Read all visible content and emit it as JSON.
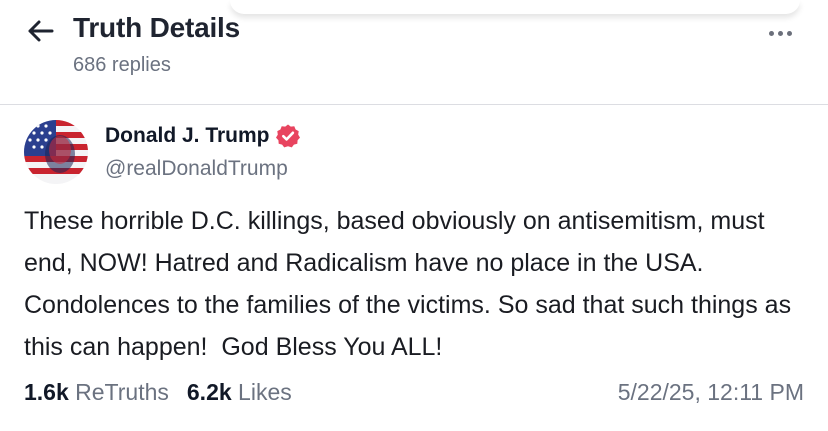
{
  "header": {
    "title": "Truth Details",
    "replies": "686 replies"
  },
  "post": {
    "author": {
      "name": "Donald J. Trump",
      "handle": "@realDonaldTrump",
      "verified": true
    },
    "text": "These horrible D.C. killings, based obviously on antisemitism, must end, NOW! Hatred and Radicalism have no place in the USA. Condolences to the families of the victims. So sad that such things as this can happen!  God Bless You ALL!",
    "retruths_count": "1.6k",
    "retruths_label": "ReTruths",
    "likes_count": "6.2k",
    "likes_label": "Likes",
    "timestamp": "5/22/25, 12:11 PM"
  },
  "icons": {
    "back": "arrow-left-icon",
    "more": "more-horizontal-icon",
    "verified": "verified-badge-icon"
  },
  "colors": {
    "verified_badge": "#e8445f",
    "muted_text": "#6b7280",
    "primary_text": "#111827"
  }
}
